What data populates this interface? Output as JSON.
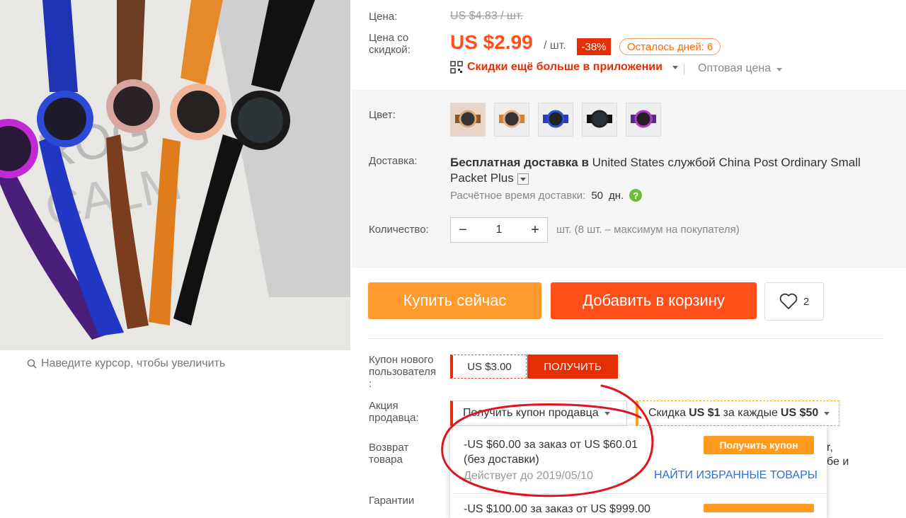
{
  "colors": {
    "accent": "#ff4e1a",
    "sale_red": "#e62e04",
    "orange": "#ff9a2e",
    "link": "#2f6fd6"
  },
  "photo": {
    "hint": "Наведите курсор, чтобы увеличить"
  },
  "labels": {
    "price": "Цена:",
    "discount_price": [
      "Цена со",
      "скидкой:"
    ],
    "color": "Цвет:",
    "shipping": "Доставка:",
    "quantity": "Количество:",
    "new_user_coupon": [
      "Купон нового",
      "пользователя",
      ":"
    ],
    "seller_promo": [
      "Акция",
      "продавца:"
    ],
    "returns": [
      "Возврат",
      "товара"
    ],
    "guarantee": "Гарантии"
  },
  "price": {
    "original": "US $4.83 / шт.",
    "current": "US $2.99",
    "unit": "/ шт.",
    "discount": "-38%",
    "days_left": "Осталось дней: 6",
    "app_promo": "Скидки ещё больше в приложении",
    "wholesale": "Оптовая цена"
  },
  "colors_swatches": [
    "orange-strap-1",
    "orange-strap-2",
    "blue",
    "black",
    "purple"
  ],
  "shipping": {
    "line1_bold": "Бесплатная доставка в",
    "line1_rest": " United States службой China Post Ordinary Small",
    "line2": "Packet Plus",
    "eta_label": "Расчётное время доставки:",
    "eta_value": "50",
    "eta_unit": "дн."
  },
  "quantity": {
    "value": "1",
    "note": "шт. (8 шт. – максимум на покупателя)",
    "minus": "−",
    "plus": "+"
  },
  "actions": {
    "buy_now": "Купить сейчас",
    "add_to_cart": "Добавить в корзину",
    "wish_count": "2"
  },
  "coupon": {
    "amount": "US $3.00",
    "get": "ПОЛУЧИТЬ"
  },
  "seller": {
    "select": "Получить купон продавца",
    "discount_prefix": "Скидка ",
    "discount_amount": "US $1",
    "discount_mid": " за каждые ",
    "discount_threshold": "US $50"
  },
  "dropdown": {
    "item1": "-US $60.00 за заказ от US $60.01",
    "item1_note": "(без доставки)",
    "valid": "Действует до 2019/05/10",
    "get_coupon": "Получить купон",
    "find_favorites": "НАЙТИ ИЗБРАННЫЕ ТОВАРЫ",
    "item2": "-US $100.00 за заказ от US $999.00"
  },
  "overflow_text": {
    "a": "r,",
    "b": "бе и"
  }
}
